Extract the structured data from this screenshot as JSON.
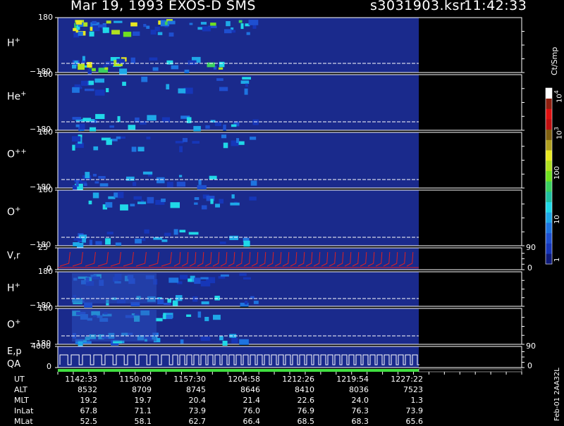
{
  "header": {
    "title": "Mar 19, 1993   EXOS-D SMS",
    "file": "s3031903.ksr",
    "time": "11:42:33"
  },
  "colorbar": {
    "unit": "Ct/Smp",
    "ticks": [
      "1",
      "10",
      "100",
      "10",
      "10"
    ],
    "exp": [
      "",
      "",
      "",
      "3",
      "4"
    ],
    "colors": [
      "#0d1a7a",
      "#1636b8",
      "#1e4fd0",
      "#1e74e0",
      "#1ea8e8",
      "#20d8e8",
      "#20c0a0",
      "#3ad060",
      "#70e020",
      "#b0e020",
      "#e8e820",
      "#b0a020",
      "#806010",
      "#c01010",
      "#e01010",
      "#902010",
      "#ffffff"
    ]
  },
  "panels": [
    {
      "label": "H",
      "sup": "+",
      "top": "180",
      "bottom": "−180"
    },
    {
      "label": "He",
      "sup": "+",
      "top": "180",
      "bottom": "−180"
    },
    {
      "label": "O",
      "sup": "++",
      "top": "180",
      "bottom": "−180"
    },
    {
      "label": "O",
      "sup": "+",
      "top": "180",
      "bottom": "−180"
    },
    {
      "label": "V,r",
      "sup": "",
      "top": "25",
      "bottom": "0",
      "right_top": "90",
      "right_bottom": "0"
    },
    {
      "label": "H",
      "sup": "+",
      "top": "180",
      "bottom": "−180"
    },
    {
      "label": "O",
      "sup": "+",
      "top": "180",
      "bottom": "−180"
    },
    {
      "label": "E,p",
      "sup": "",
      "top": "4000",
      "bottom": "0",
      "right_top": "90",
      "right_bottom": "0"
    }
  ],
  "qa_label": "QA",
  "side_note": "Feb-01 2AA32L",
  "table": {
    "rows": [
      {
        "name": "UT",
        "values": [
          "1142:33",
          "1150:09",
          "1157:30",
          "1204:58",
          "1212:26",
          "1219:54",
          "1227:22"
        ]
      },
      {
        "name": "ALT",
        "values": [
          "8532",
          "8709",
          "8745",
          "8646",
          "8410",
          "8036",
          "7523"
        ]
      },
      {
        "name": "MLT",
        "values": [
          "19.2",
          "19.7",
          "20.4",
          "21.4",
          "22.6",
          "24.0",
          "1.3"
        ]
      },
      {
        "name": "InLat",
        "values": [
          "67.8",
          "71.1",
          "73.9",
          "76.0",
          "76.9",
          "76.3",
          "73.9"
        ]
      },
      {
        "name": "MLat",
        "values": [
          "52.5",
          "58.1",
          "62.7",
          "66.4",
          "68.5",
          "68.3",
          "65.6"
        ]
      }
    ]
  },
  "chart_data": {
    "type": "heatmap",
    "title": "Mar 19, 1993   EXOS-D SMS",
    "x": [
      "1142:33",
      "1150:09",
      "1157:30",
      "1204:58",
      "1212:26",
      "1219:54",
      "1227:22"
    ],
    "colorbar_label": "Ct/Smp",
    "colorbar_range": [
      1,
      10000
    ],
    "panels": [
      {
        "name": "H+",
        "ylim": [
          -180,
          180
        ]
      },
      {
        "name": "He+",
        "ylim": [
          -180,
          180
        ]
      },
      {
        "name": "O++",
        "ylim": [
          -180,
          180
        ]
      },
      {
        "name": "O+",
        "ylim": [
          -180,
          180
        ]
      },
      {
        "name": "V,r",
        "ylim": [
          0,
          25
        ],
        "right_ylim": [
          0,
          90
        ]
      },
      {
        "name": "H+",
        "ylim": [
          -180,
          180
        ]
      },
      {
        "name": "O+",
        "ylim": [
          -180,
          180
        ]
      },
      {
        "name": "E,p",
        "ylim": [
          0,
          4000
        ],
        "right_ylim": [
          0,
          90
        ]
      }
    ],
    "ephemeris": {
      "UT": [
        "1142:33",
        "1150:09",
        "1157:30",
        "1204:58",
        "1212:26",
        "1219:54",
        "1227:22"
      ],
      "ALT": [
        8532,
        8709,
        8745,
        8646,
        8410,
        8036,
        7523
      ],
      "MLT": [
        19.2,
        19.7,
        20.4,
        21.4,
        22.6,
        24.0,
        1.3
      ],
      "InLat": [
        67.8,
        71.1,
        73.9,
        76.0,
        76.9,
        76.3,
        73.9
      ],
      "MLat": [
        52.5,
        58.1,
        62.7,
        66.4,
        68.5,
        68.3,
        65.6
      ]
    }
  }
}
